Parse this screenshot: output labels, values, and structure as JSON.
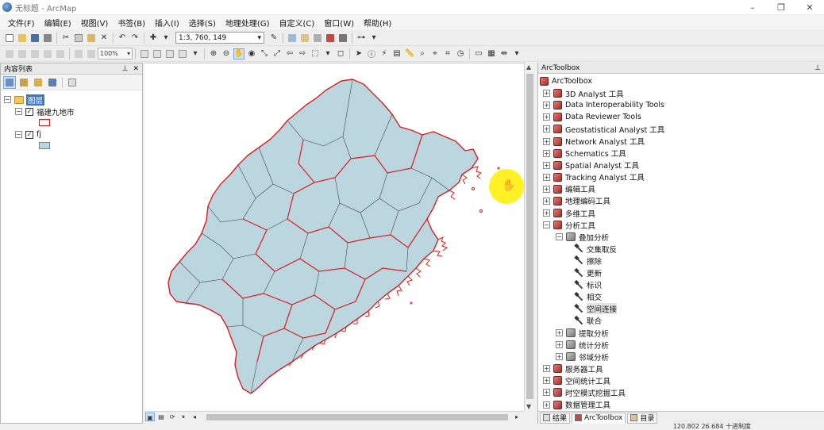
{
  "window": {
    "title": "无标题 - ArcMap",
    "minimize": "–",
    "maximize": "❐",
    "close": "✕"
  },
  "menu": [
    "文件(F)",
    "编辑(E)",
    "视图(V)",
    "书签(B)",
    "插入(I)",
    "选择(S)",
    "地理处理(G)",
    "自定义(C)",
    "窗口(W)",
    "帮助(H)"
  ],
  "toolbar": {
    "scale": "1:3, 760, 149",
    "zoom": "100%"
  },
  "toc": {
    "title": "内容列表",
    "pin": "⊥",
    "close": "✕",
    "layers_root": "图层",
    "layer1": "福建九地市",
    "layer2": "fj"
  },
  "toolbox": {
    "title": "ArcToolbox",
    "pin": "⊥",
    "root": "ArcToolbox",
    "items": [
      {
        "label": "3D Analyst 工具",
        "level": 0,
        "exp": "+",
        "kind": "box"
      },
      {
        "label": "Data Interoperability Tools",
        "level": 0,
        "exp": "+",
        "kind": "box"
      },
      {
        "label": "Data Reviewer Tools",
        "level": 0,
        "exp": "+",
        "kind": "box"
      },
      {
        "label": "Geostatistical Analyst 工具",
        "level": 0,
        "exp": "+",
        "kind": "box"
      },
      {
        "label": "Network Analyst 工具",
        "level": 0,
        "exp": "+",
        "kind": "box"
      },
      {
        "label": "Schematics 工具",
        "level": 0,
        "exp": "+",
        "kind": "box"
      },
      {
        "label": "Spatial Analyst 工具",
        "level": 0,
        "exp": "+",
        "kind": "box"
      },
      {
        "label": "Tracking Analyst 工具",
        "level": 0,
        "exp": "+",
        "kind": "box"
      },
      {
        "label": "编辑工具",
        "level": 0,
        "exp": "+",
        "kind": "box"
      },
      {
        "label": "地理编码工具",
        "level": 0,
        "exp": "+",
        "kind": "box"
      },
      {
        "label": "多维工具",
        "level": 0,
        "exp": "+",
        "kind": "box"
      },
      {
        "label": "分析工具",
        "level": 0,
        "exp": "−",
        "kind": "box"
      },
      {
        "label": "叠加分析",
        "level": 1,
        "exp": "−",
        "kind": "toolset"
      },
      {
        "label": "交集取反",
        "level": 2,
        "exp": "",
        "kind": "tool"
      },
      {
        "label": "擦除",
        "level": 2,
        "exp": "",
        "kind": "tool"
      },
      {
        "label": "更新",
        "level": 2,
        "exp": "",
        "kind": "tool"
      },
      {
        "label": "标识",
        "level": 2,
        "exp": "",
        "kind": "tool"
      },
      {
        "label": "相交",
        "level": 2,
        "exp": "",
        "kind": "tool"
      },
      {
        "label": "空间连接",
        "level": 2,
        "exp": "",
        "kind": "tool",
        "highlight": true
      },
      {
        "label": "联合",
        "level": 2,
        "exp": "",
        "kind": "tool"
      },
      {
        "label": "提取分析",
        "level": 1,
        "exp": "+",
        "kind": "toolset"
      },
      {
        "label": "统计分析",
        "level": 1,
        "exp": "+",
        "kind": "toolset"
      },
      {
        "label": "邻域分析",
        "level": 1,
        "exp": "+",
        "kind": "toolset"
      },
      {
        "label": "服务器工具",
        "level": 0,
        "exp": "+",
        "kind": "box"
      },
      {
        "label": "空间统计工具",
        "level": 0,
        "exp": "+",
        "kind": "box"
      },
      {
        "label": "时空模式挖掘工具",
        "level": 0,
        "exp": "+",
        "kind": "box"
      },
      {
        "label": "数据管理工具",
        "level": 0,
        "exp": "+",
        "kind": "box"
      }
    ],
    "tabs": [
      "结果",
      "ArcToolbox",
      "目录"
    ]
  },
  "status": {
    "coords": "120.802  26.684 十进制度"
  },
  "colors": {
    "land_fill": "#bcd6e0",
    "county_border": "#3a3a3a",
    "city_border": "#d42020",
    "selection": "#3a76c4"
  }
}
